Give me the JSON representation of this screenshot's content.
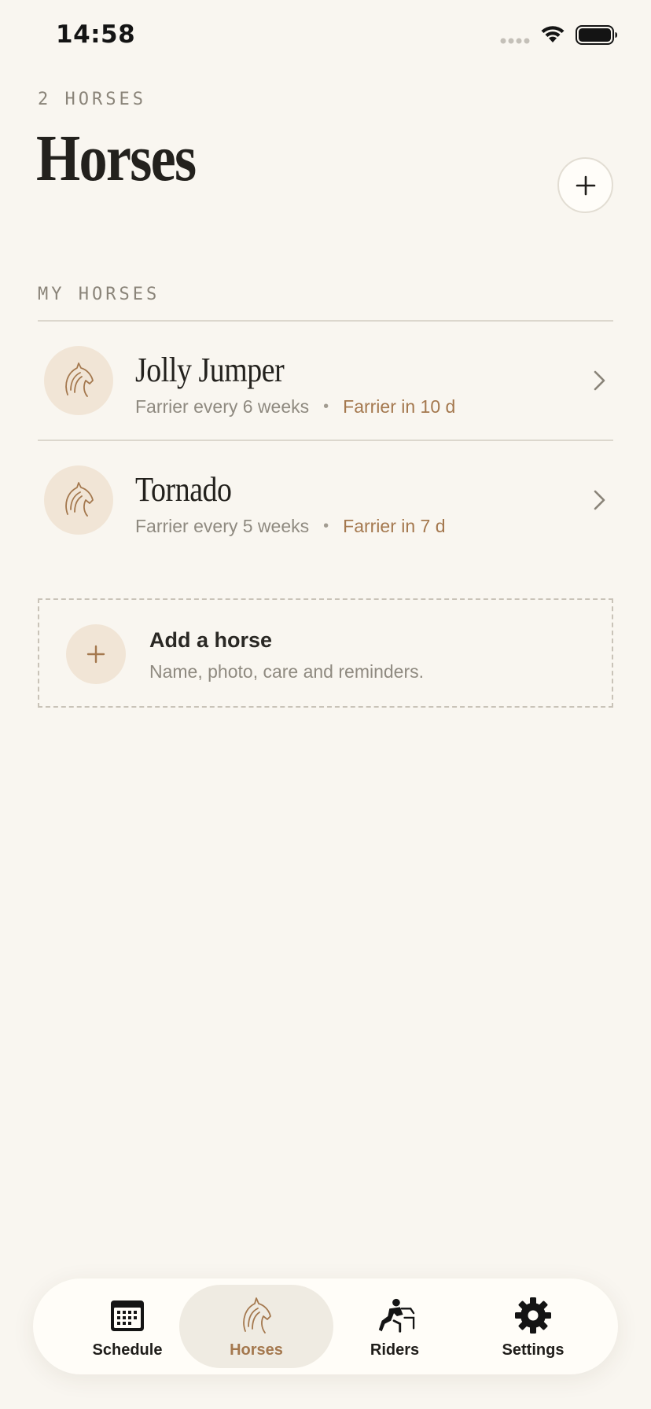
{
  "status_bar": {
    "time": "14:58"
  },
  "header": {
    "count_label": "2 HORSES",
    "title": "Horses"
  },
  "section": {
    "label": "MY HORSES"
  },
  "horses": [
    {
      "name": "Jolly Jumper",
      "interval": "Farrier every 6 weeks",
      "due": "Farrier in 10 d"
    },
    {
      "name": "Tornado",
      "interval": "Farrier every 5 weeks",
      "due": "Farrier in 7 d"
    }
  ],
  "add_card": {
    "title": "Add a horse",
    "subtitle": "Name, photo, care and reminders."
  },
  "tab_bar": {
    "tabs": [
      {
        "label": "Schedule",
        "icon": "calendar-icon",
        "active": false
      },
      {
        "label": "Horses",
        "icon": "horse-head-icon",
        "active": true
      },
      {
        "label": "Riders",
        "icon": "rider-icon",
        "active": false
      },
      {
        "label": "Settings",
        "icon": "gear-icon",
        "active": false
      }
    ]
  },
  "colors": {
    "background": "#f9f6f0",
    "accent": "#a4784e",
    "avatar_bg": "#f1e5d6",
    "active_tab_bg": "#efebe2"
  }
}
